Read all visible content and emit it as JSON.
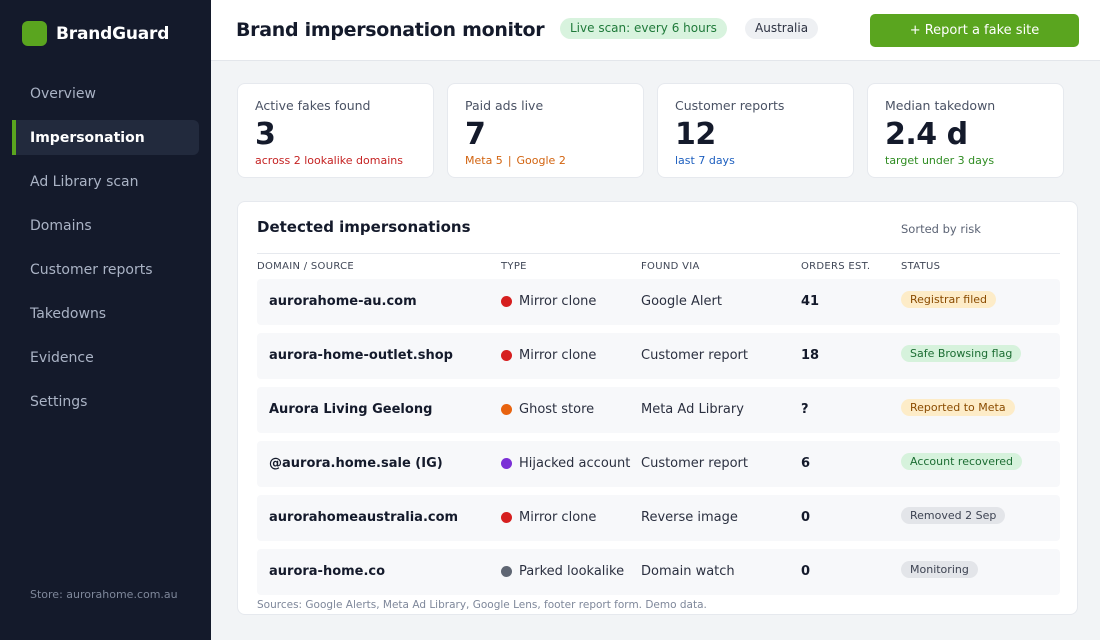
{
  "app": {
    "brand": "BrandGuard",
    "brand_color": "#5aa51f"
  },
  "sidebar": {
    "items": [
      {
        "label": "Overview",
        "active": false
      },
      {
        "label": "Impersonation",
        "active": true
      },
      {
        "label": "Ad Library scan",
        "active": false
      },
      {
        "label": "Domains",
        "active": false
      },
      {
        "label": "Customer reports",
        "active": false
      },
      {
        "label": "Takedowns",
        "active": false
      },
      {
        "label": "Evidence",
        "active": false
      },
      {
        "label": "Settings",
        "active": false
      }
    ],
    "store": "Store: aurorahome.com.au"
  },
  "header": {
    "title": "Brand impersonation monitor",
    "scan_pill": "Live scan: every 6 hours",
    "region_pill": "Australia",
    "report_button": "+ Report a fake site"
  },
  "kpis": [
    {
      "label": "Active fakes found",
      "value": "3",
      "sub": "across 2 lookalike domains"
    },
    {
      "label": "Paid ads live",
      "value": "7",
      "sub_a": "Meta 5",
      "sub_sep": "|",
      "sub_b": "Google 2"
    },
    {
      "label": "Customer reports",
      "value": "12",
      "sub": "last 7 days"
    },
    {
      "label": "Median takedown",
      "value": "2.4 d",
      "sub": "target under 3 days"
    }
  ],
  "table": {
    "title": "Detected impersonations",
    "sort_note": "Sorted by risk",
    "columns": [
      "DOMAIN / SOURCE",
      "TYPE",
      "FOUND VIA",
      "ORDERS EST.",
      "STATUS"
    ],
    "rows": [
      {
        "domain": "aurorahome-au.com",
        "type": "Mirror clone",
        "type_color": "#d61f1f",
        "found_via": "Google Alert",
        "orders": "41",
        "status": "Registrar filed",
        "status_style": "amber"
      },
      {
        "domain": "aurora-home-outlet.shop",
        "type": "Mirror clone",
        "type_color": "#d61f1f",
        "found_via": "Customer report",
        "orders": "18",
        "status": "Safe Browsing flag",
        "status_style": "green"
      },
      {
        "domain": "Aurora Living Geelong",
        "type": "Ghost store",
        "type_color": "#e8630f",
        "found_via": "Meta Ad Library",
        "orders": "?",
        "status": "Reported to Meta",
        "status_style": "amber"
      },
      {
        "domain": "@aurora.home.sale (IG)",
        "type": "Hijacked account",
        "type_color": "#7b2fd6",
        "found_via": "Customer report",
        "orders": "6",
        "status": "Account recovered",
        "status_style": "green"
      },
      {
        "domain": "aurorahomeaustralia.com",
        "type": "Mirror clone",
        "type_color": "#d61f1f",
        "found_via": "Reverse image",
        "orders": "0",
        "status": "Removed 2 Sep",
        "status_style": "grey"
      },
      {
        "domain": "aurora-home.co",
        "type": "Parked lookalike",
        "type_color": "#5f6673",
        "found_via": "Domain watch",
        "orders": "0",
        "status": "Monitoring",
        "status_style": "grey"
      }
    ],
    "sources": "Sources: Google Alerts, Meta Ad Library, Google Lens, footer report form. Demo data."
  }
}
